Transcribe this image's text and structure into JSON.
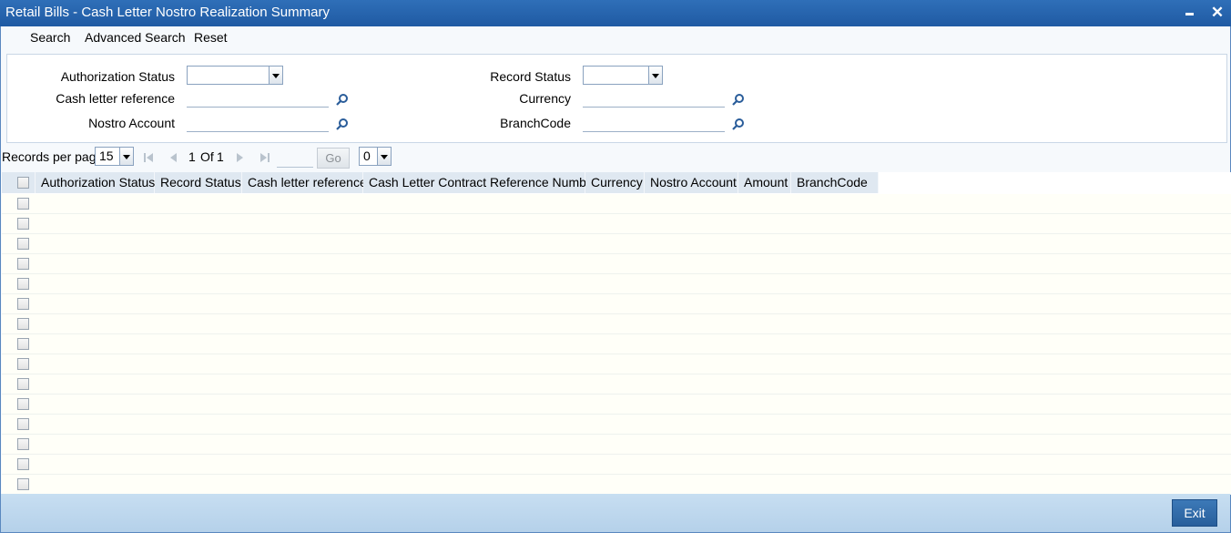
{
  "window": {
    "title": "Retail Bills - Cash Letter Nostro Realization Summary",
    "minimize_icon": "minimize-icon",
    "close_icon": "close-icon"
  },
  "toolbar": {
    "search": "Search",
    "advanced_search": "Advanced Search",
    "reset": "Reset"
  },
  "search_form": {
    "authorization_status": {
      "label": "Authorization Status",
      "value": ""
    },
    "record_status": {
      "label": "Record Status",
      "value": ""
    },
    "cash_letter_reference": {
      "label": "Cash letter reference",
      "value": ""
    },
    "currency": {
      "label": "Currency",
      "value": ""
    },
    "nostro_account": {
      "label": "Nostro Account",
      "value": ""
    },
    "branch_code": {
      "label": "BranchCode",
      "value": ""
    }
  },
  "pager": {
    "records_per_page_label": "Records per page",
    "records_per_page": "15",
    "current_page": "1",
    "of_label": "Of",
    "total_pages": "1",
    "go_label": "Go",
    "page_input": "",
    "extra_select": "0"
  },
  "grid": {
    "columns": [
      "Authorization Status",
      "Record Status",
      "Cash letter reference",
      "Cash Letter Contract Reference Number",
      "Currency",
      "Nostro Account",
      "Amount",
      "BranchCode"
    ],
    "empty_row_count": 15
  },
  "footer": {
    "exit": "Exit"
  }
}
